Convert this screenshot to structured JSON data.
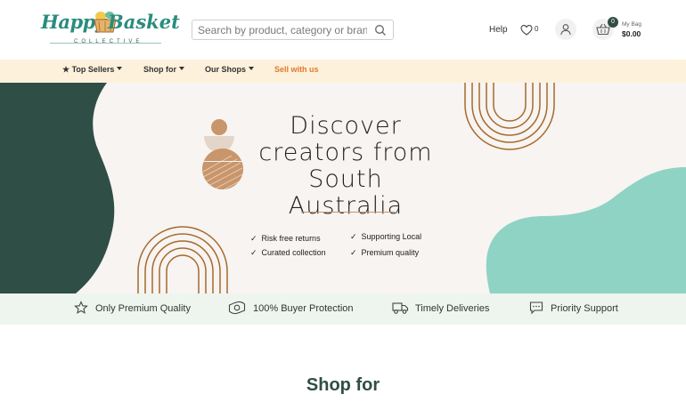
{
  "logo": {
    "text_main": "Happy",
    "text_second": "Basket",
    "text_sub": "COLLECTIVE"
  },
  "search": {
    "placeholder": "Search by product, category or brand",
    "value": ""
  },
  "header": {
    "help_label": "Help",
    "wishlist_count": "0",
    "bag_count": "0",
    "bag_title": "My Bag",
    "bag_total": "$0.00"
  },
  "nav": {
    "items": [
      {
        "label": "Top Sellers"
      },
      {
        "label": "Shop for"
      },
      {
        "label": "Our Shops"
      },
      {
        "label": "Sell with us"
      }
    ]
  },
  "hero": {
    "title_line1": "Discover",
    "title_line2": "creators from",
    "title_line3": "South Australia",
    "features": [
      "Risk free returns",
      "Curated collection",
      "Supporting Local",
      "Premium quality"
    ],
    "check_glyph": "✓"
  },
  "benefits": [
    {
      "label": "Only Premium Quality",
      "icon": "star-icon"
    },
    {
      "label": "100% Buyer Protection",
      "icon": "money-icon"
    },
    {
      "label": "Timely Deliveries",
      "icon": "truck-icon"
    },
    {
      "label": "Priority Support",
      "icon": "chat-icon"
    }
  ],
  "section": {
    "title": "Shop for"
  },
  "colors": {
    "brand_teal": "#2a8c7e",
    "dark_green": "#2f4e46",
    "nav_bg": "#fdf1db",
    "accent_orange": "#e07a2a",
    "hero_bg": "#f7f4f2",
    "mint": "#8fd3c4",
    "arch_brown": "#a66a2c",
    "benefits_bg": "#eef5ee"
  }
}
